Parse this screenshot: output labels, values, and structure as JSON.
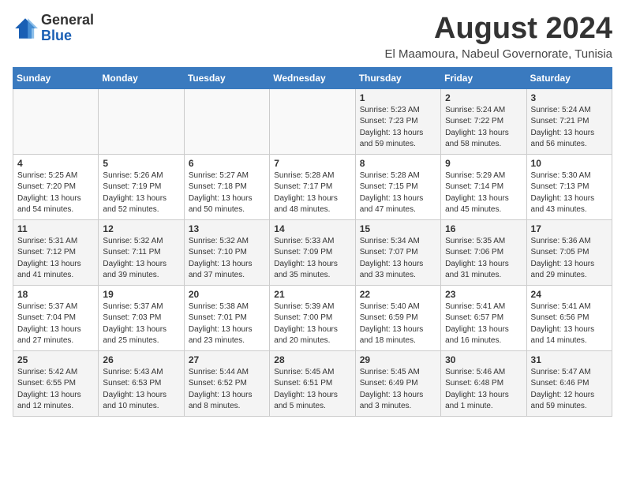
{
  "logo": {
    "general": "General",
    "blue": "Blue"
  },
  "title": "August 2024",
  "location": "El Maamoura, Nabeul Governorate, Tunisia",
  "days_of_week": [
    "Sunday",
    "Monday",
    "Tuesday",
    "Wednesday",
    "Thursday",
    "Friday",
    "Saturday"
  ],
  "weeks": [
    [
      {
        "day": "",
        "info": ""
      },
      {
        "day": "",
        "info": ""
      },
      {
        "day": "",
        "info": ""
      },
      {
        "day": "",
        "info": ""
      },
      {
        "day": "1",
        "info": "Sunrise: 5:23 AM\nSunset: 7:23 PM\nDaylight: 13 hours\nand 59 minutes."
      },
      {
        "day": "2",
        "info": "Sunrise: 5:24 AM\nSunset: 7:22 PM\nDaylight: 13 hours\nand 58 minutes."
      },
      {
        "day": "3",
        "info": "Sunrise: 5:24 AM\nSunset: 7:21 PM\nDaylight: 13 hours\nand 56 minutes."
      }
    ],
    [
      {
        "day": "4",
        "info": "Sunrise: 5:25 AM\nSunset: 7:20 PM\nDaylight: 13 hours\nand 54 minutes."
      },
      {
        "day": "5",
        "info": "Sunrise: 5:26 AM\nSunset: 7:19 PM\nDaylight: 13 hours\nand 52 minutes."
      },
      {
        "day": "6",
        "info": "Sunrise: 5:27 AM\nSunset: 7:18 PM\nDaylight: 13 hours\nand 50 minutes."
      },
      {
        "day": "7",
        "info": "Sunrise: 5:28 AM\nSunset: 7:17 PM\nDaylight: 13 hours\nand 48 minutes."
      },
      {
        "day": "8",
        "info": "Sunrise: 5:28 AM\nSunset: 7:15 PM\nDaylight: 13 hours\nand 47 minutes."
      },
      {
        "day": "9",
        "info": "Sunrise: 5:29 AM\nSunset: 7:14 PM\nDaylight: 13 hours\nand 45 minutes."
      },
      {
        "day": "10",
        "info": "Sunrise: 5:30 AM\nSunset: 7:13 PM\nDaylight: 13 hours\nand 43 minutes."
      }
    ],
    [
      {
        "day": "11",
        "info": "Sunrise: 5:31 AM\nSunset: 7:12 PM\nDaylight: 13 hours\nand 41 minutes."
      },
      {
        "day": "12",
        "info": "Sunrise: 5:32 AM\nSunset: 7:11 PM\nDaylight: 13 hours\nand 39 minutes."
      },
      {
        "day": "13",
        "info": "Sunrise: 5:32 AM\nSunset: 7:10 PM\nDaylight: 13 hours\nand 37 minutes."
      },
      {
        "day": "14",
        "info": "Sunrise: 5:33 AM\nSunset: 7:09 PM\nDaylight: 13 hours\nand 35 minutes."
      },
      {
        "day": "15",
        "info": "Sunrise: 5:34 AM\nSunset: 7:07 PM\nDaylight: 13 hours\nand 33 minutes."
      },
      {
        "day": "16",
        "info": "Sunrise: 5:35 AM\nSunset: 7:06 PM\nDaylight: 13 hours\nand 31 minutes."
      },
      {
        "day": "17",
        "info": "Sunrise: 5:36 AM\nSunset: 7:05 PM\nDaylight: 13 hours\nand 29 minutes."
      }
    ],
    [
      {
        "day": "18",
        "info": "Sunrise: 5:37 AM\nSunset: 7:04 PM\nDaylight: 13 hours\nand 27 minutes."
      },
      {
        "day": "19",
        "info": "Sunrise: 5:37 AM\nSunset: 7:03 PM\nDaylight: 13 hours\nand 25 minutes."
      },
      {
        "day": "20",
        "info": "Sunrise: 5:38 AM\nSunset: 7:01 PM\nDaylight: 13 hours\nand 23 minutes."
      },
      {
        "day": "21",
        "info": "Sunrise: 5:39 AM\nSunset: 7:00 PM\nDaylight: 13 hours\nand 20 minutes."
      },
      {
        "day": "22",
        "info": "Sunrise: 5:40 AM\nSunset: 6:59 PM\nDaylight: 13 hours\nand 18 minutes."
      },
      {
        "day": "23",
        "info": "Sunrise: 5:41 AM\nSunset: 6:57 PM\nDaylight: 13 hours\nand 16 minutes."
      },
      {
        "day": "24",
        "info": "Sunrise: 5:41 AM\nSunset: 6:56 PM\nDaylight: 13 hours\nand 14 minutes."
      }
    ],
    [
      {
        "day": "25",
        "info": "Sunrise: 5:42 AM\nSunset: 6:55 PM\nDaylight: 13 hours\nand 12 minutes."
      },
      {
        "day": "26",
        "info": "Sunrise: 5:43 AM\nSunset: 6:53 PM\nDaylight: 13 hours\nand 10 minutes."
      },
      {
        "day": "27",
        "info": "Sunrise: 5:44 AM\nSunset: 6:52 PM\nDaylight: 13 hours\nand 8 minutes."
      },
      {
        "day": "28",
        "info": "Sunrise: 5:45 AM\nSunset: 6:51 PM\nDaylight: 13 hours\nand 5 minutes."
      },
      {
        "day": "29",
        "info": "Sunrise: 5:45 AM\nSunset: 6:49 PM\nDaylight: 13 hours\nand 3 minutes."
      },
      {
        "day": "30",
        "info": "Sunrise: 5:46 AM\nSunset: 6:48 PM\nDaylight: 13 hours\nand 1 minute."
      },
      {
        "day": "31",
        "info": "Sunrise: 5:47 AM\nSunset: 6:46 PM\nDaylight: 12 hours\nand 59 minutes."
      }
    ]
  ]
}
